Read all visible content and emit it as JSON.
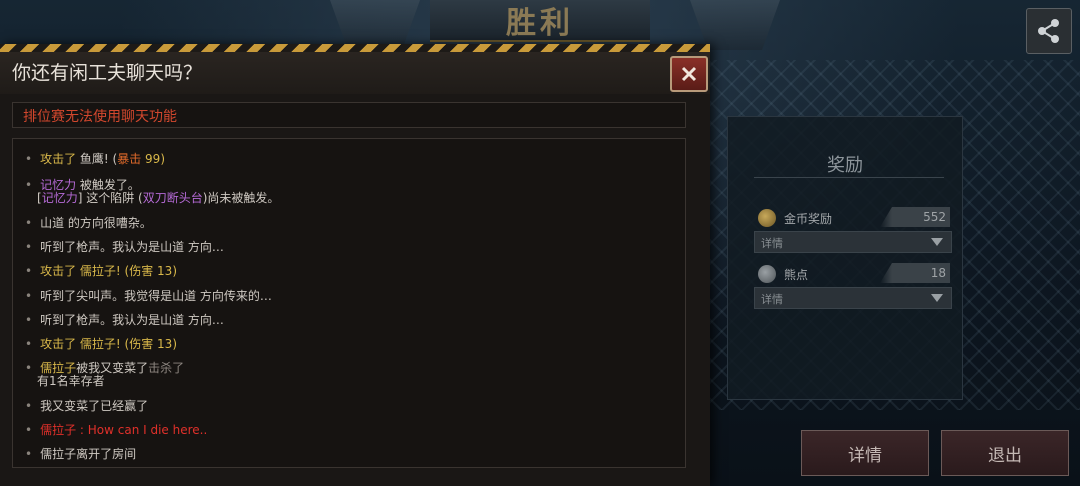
{
  "header": {
    "title": "胜利"
  },
  "share": {
    "icon": "share-icon"
  },
  "dialog": {
    "title": "你还有闲工夫聊天吗？",
    "notice": "排位赛无法使用聊天功能",
    "close_icon": "close-icon",
    "log": {
      "l1": {
        "a": "攻击了",
        "b": " 鱼鹰! (",
        "c": "暴击",
        "d": " 99)"
      },
      "l2": {
        "a": "记忆力",
        "b": " 被触发了。"
      },
      "l2b": {
        "a": "[",
        "b": "记忆力",
        "c": "] 这个陷阱 (",
        "d": "双刀断头台",
        "e": ")尚未被触发。"
      },
      "l3": "山道 的方向很嘈杂。",
      "l4": "听到了枪声。我认为是山道 方向…",
      "l5": {
        "a": "攻击了",
        "b": " 儒拉子! (伤害 ",
        "c": "13",
        "d": ")"
      },
      "l6": "听到了尖叫声。我觉得是山道 方向传来的…",
      "l7": "听到了枪声。我认为是山道 方向…",
      "l8": {
        "a": "攻击了",
        "b": " 儒拉子! (伤害 ",
        "c": "13",
        "d": ")"
      },
      "l9": {
        "a": "儒拉子",
        "b": "被我又变菜了",
        "c": "击杀了"
      },
      "l9b": "有1名幸存者",
      "l10": "我又变菜了已经赢了",
      "l11": {
        "a": "儒拉子",
        "b": " : How can I die here.."
      },
      "l12": "儒拉子离开了房间"
    }
  },
  "rewards": {
    "title": "奖励",
    "coin": {
      "label": "金币奖励",
      "value": "552",
      "detail": "详情"
    },
    "bear": {
      "label": "熊点",
      "value": "18",
      "detail": "详情"
    }
  },
  "buttons": {
    "details": "详情",
    "exit": "退出"
  },
  "colors": {
    "accent_red": "#d1472d",
    "hazard_yellow": "#c89a3a",
    "attack_yellow": "#d9b84a",
    "skill_purple": "#b56ad6"
  }
}
